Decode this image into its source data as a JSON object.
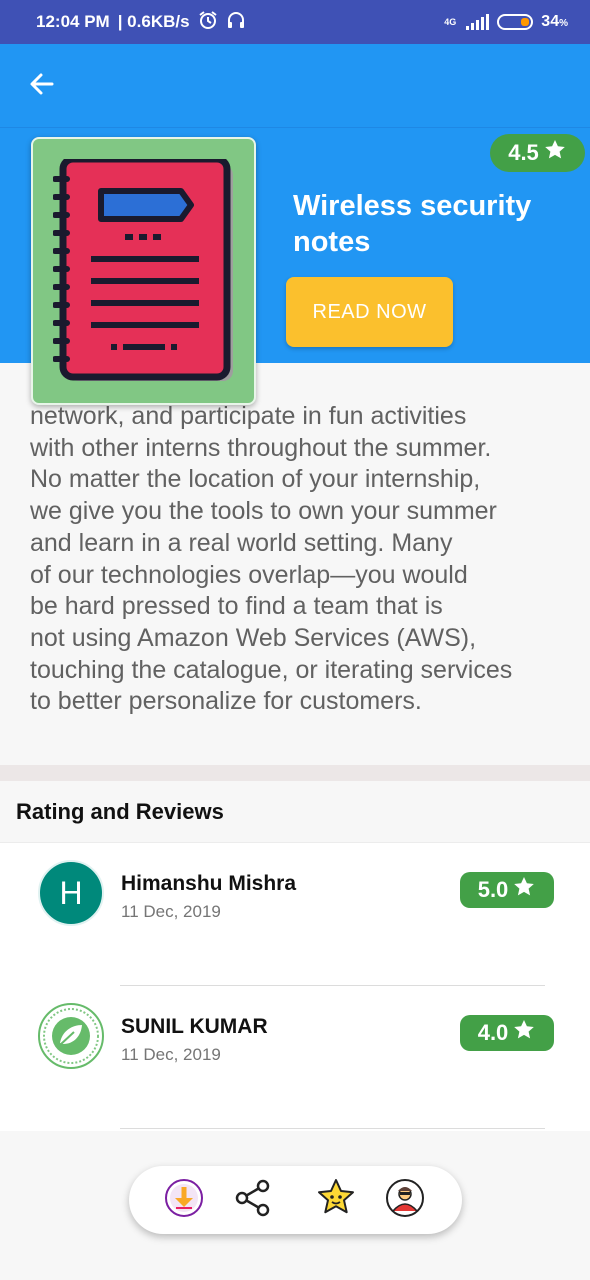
{
  "status_bar": {
    "time": "12:04 PM",
    "speed": "| 0.6KB/s",
    "network_label": "4G",
    "battery": "34",
    "battery_unit": "%",
    "icons": [
      "alarm-icon",
      "headphones-icon",
      "signal-icon",
      "battery-icon"
    ]
  },
  "toolbar": {
    "back_icon": "arrow-left-icon"
  },
  "book": {
    "title": "Wireless security notes",
    "rating": "4.5",
    "read_button": "READ NOW",
    "cover_icon": "notebook-icon"
  },
  "description": "network, and participate in fun activities\nwith other interns throughout the summer.\nNo matter the location of your internship,\nwe give you the tools to own your summer\nand learn in a real world setting. Many\nof our technologies overlap—you would\nbe hard pressed to find a team that is\nnot using Amazon Web Services (AWS),\ntouching the catalogue, or iterating services\nto better personalize for customers.",
  "reviews": {
    "title": "Rating and Reviews",
    "items": [
      {
        "initial": "H",
        "name": "Himanshu Mishra",
        "date": "11 Dec, 2019",
        "score": "5.0"
      },
      {
        "initial": "",
        "name": "SUNIL KUMAR",
        "date": "11 Dec, 2019",
        "score": "4.0"
      }
    ]
  },
  "bottom_bar": {
    "icons": [
      "download-icon",
      "share-icon",
      "star-rate-icon",
      "profile-icon"
    ]
  },
  "colors": {
    "status_bar": "#3f51b5",
    "primary": "#2196f3",
    "rating_green": "#43a047",
    "read_button": "#fbc02d",
    "cover_green": "#81c784",
    "notebook_red": "#e53057"
  }
}
